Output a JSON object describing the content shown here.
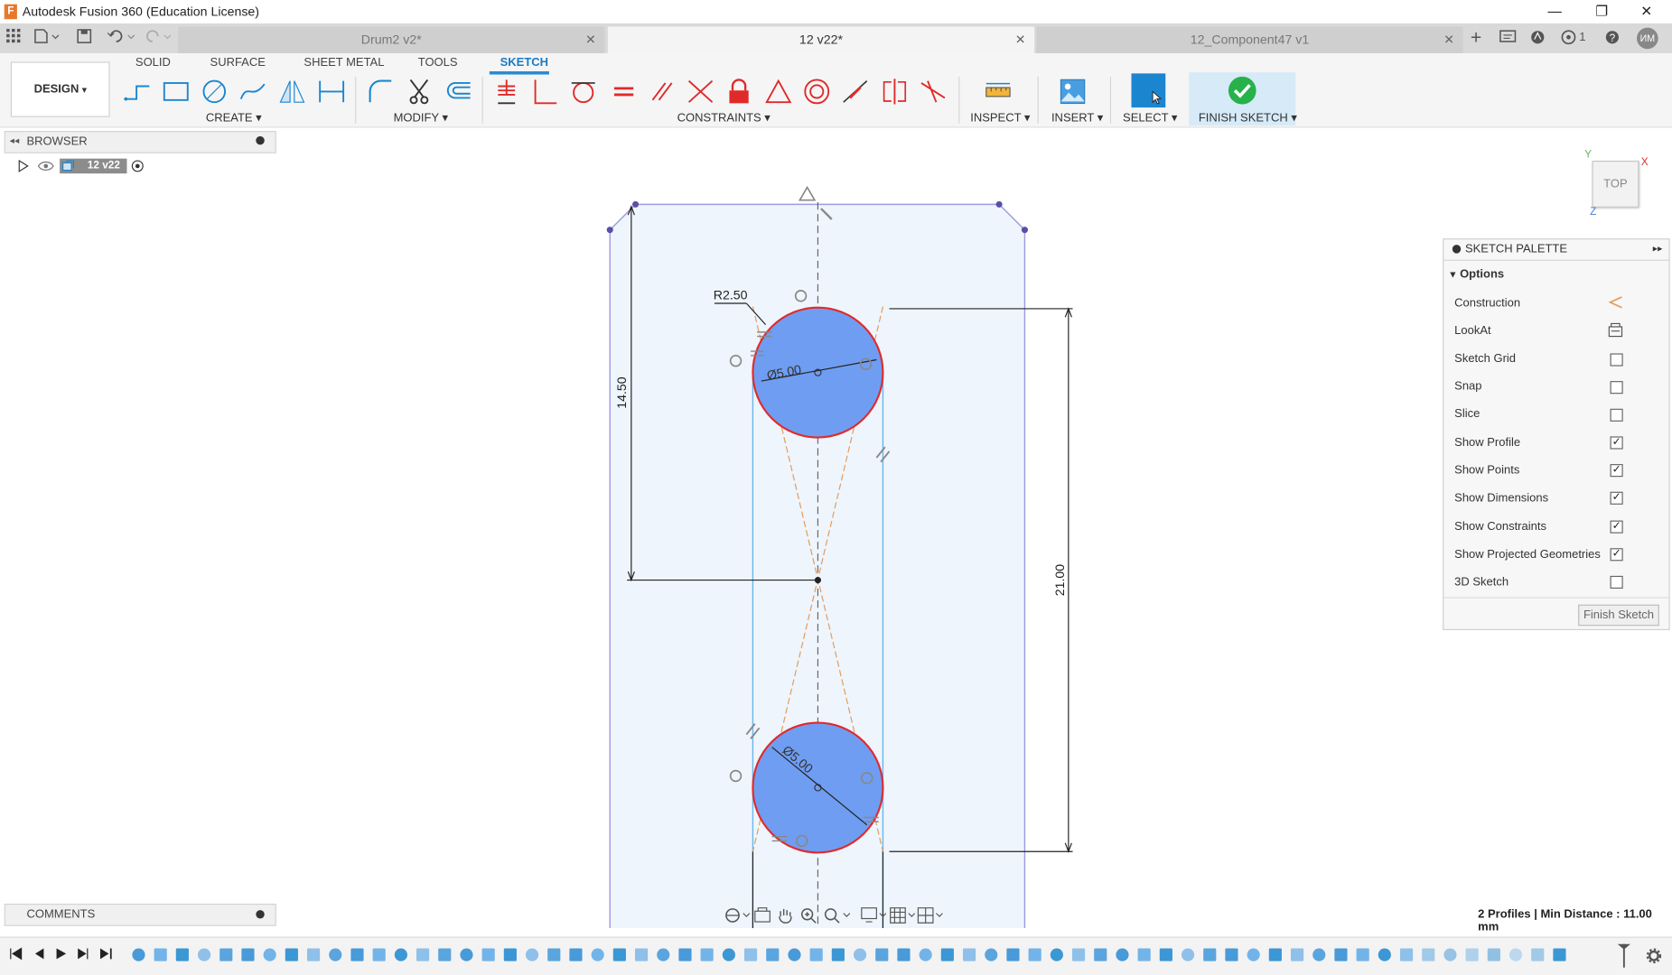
{
  "window": {
    "title": "Autodesk Fusion 360 (Education License)",
    "app_icon_letter": "F",
    "minimize": "—",
    "restore": "❐",
    "close": "✕"
  },
  "tabs": [
    {
      "label": "Drum2 v2*"
    },
    {
      "label": "12 v22*"
    },
    {
      "label": "12_Component47 v1"
    }
  ],
  "tabbar": {
    "notification_count": "1",
    "user_initials": "ИМ"
  },
  "toolbar": {
    "workspace": "DESIGN",
    "workspace_tabs": [
      "SOLID",
      "SURFACE",
      "SHEET METAL",
      "TOOLS",
      "SKETCH"
    ],
    "groups": {
      "create": "CREATE",
      "modify": "MODIFY",
      "constraints": "CONSTRAINTS",
      "inspect": "INSPECT",
      "insert": "INSERT",
      "select": "SELECT",
      "finish": "FINISH SKETCH"
    }
  },
  "browser": {
    "label": "BROWSER",
    "component": "12 v22"
  },
  "viewcube": {
    "face": "TOP",
    "axis_x": "X",
    "axis_y": "Y",
    "axis_z": "Z"
  },
  "sketch": {
    "radius_label": "R2.50",
    "diameter_top": "Ø5.00",
    "diameter_bottom": "Ø5.00",
    "dim_vertical_left": "14.50",
    "dim_vertical_right": "21.00"
  },
  "palette": {
    "title": "SKETCH PALETTE",
    "section": "Options",
    "rows": [
      {
        "label": "Construction",
        "type": "icon"
      },
      {
        "label": "LookAt",
        "type": "icon"
      },
      {
        "label": "Sketch Grid",
        "checked": false
      },
      {
        "label": "Snap",
        "checked": false
      },
      {
        "label": "Slice",
        "checked": false
      },
      {
        "label": "Show Profile",
        "checked": true
      },
      {
        "label": "Show Points",
        "checked": true
      },
      {
        "label": "Show Dimensions",
        "checked": true
      },
      {
        "label": "Show Constraints",
        "checked": true
      },
      {
        "label": "Show Projected Geometries",
        "checked": true
      },
      {
        "label": "3D Sketch",
        "checked": false
      }
    ],
    "finish_button": "Finish Sketch"
  },
  "comments": {
    "label": "COMMENTS"
  },
  "status": {
    "text": "2 Profiles | Min Distance : 11.00 mm"
  },
  "colors": {
    "accent": "#1b86cf",
    "finish_green": "#27b14a",
    "profile_fill": "#6f9df2",
    "circle_stroke": "#e02a2a",
    "construction": "#e59a5a",
    "sketch_line": "#9f9be0"
  }
}
